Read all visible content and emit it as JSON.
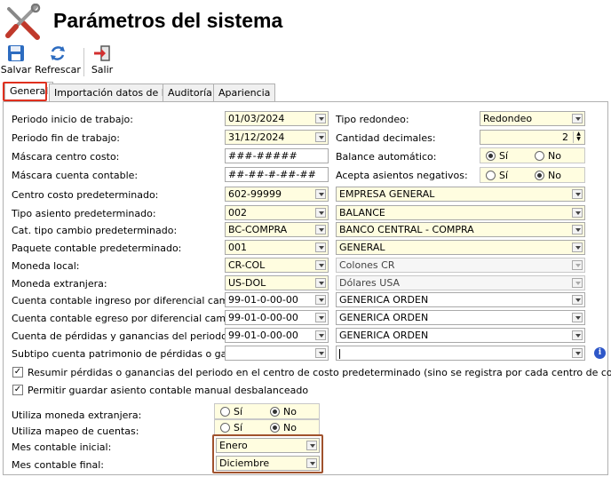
{
  "window": {
    "title": "Parámetros del sistema"
  },
  "toolbar": {
    "save_label": "Salvar",
    "refresh_label": "Refrescar",
    "exit_label": "Salir"
  },
  "tabs": [
    {
      "label": "General",
      "active": true
    },
    {
      "label": "Importación datos de RH"
    },
    {
      "label": "Auditoría"
    },
    {
      "label": "Apariencia"
    }
  ],
  "form": {
    "periodo_inicio": {
      "label": "Periodo inicio de trabajo:",
      "value": "01/03/2024"
    },
    "periodo_fin": {
      "label": "Periodo fin de trabajo:",
      "value": "31/12/2024"
    },
    "mascara_cc": {
      "label": "Máscara centro costo:",
      "value": "###-#####"
    },
    "mascara_cuenta": {
      "label": "Máscara cuenta contable:",
      "value": "##-##-#-##-##"
    },
    "tipo_redondeo": {
      "label": "Tipo redondeo:",
      "value": "Redondeo"
    },
    "cantidad_decimales": {
      "label": "Cantidad decimales:",
      "value": "2"
    },
    "balance_auto": {
      "label": "Balance automático:",
      "si": "Sí",
      "no": "No",
      "selected": "Sí"
    },
    "acepta_neg": {
      "label": "Acepta asientos negativos:",
      "si": "Sí",
      "no": "No",
      "selected": "No"
    },
    "centro_costo": {
      "label": "Centro costo predeterminado:",
      "code": "602-99999",
      "desc": "EMPRESA GENERAL"
    },
    "tipo_asiento": {
      "label": "Tipo asiento predeterminado:",
      "code": "002",
      "desc": "BALANCE"
    },
    "tipo_cambio": {
      "label": "Cat. tipo cambio predeterminado:",
      "code": "BC-COMPRA",
      "desc": "BANCO CENTRAL - COMPRA"
    },
    "paquete": {
      "label": "Paquete contable predeterminado:",
      "code": "001",
      "desc": "GENERAL"
    },
    "moneda_local": {
      "label": "Moneda local:",
      "code": "CR-COL",
      "desc": "Colones CR"
    },
    "moneda_ext": {
      "label": "Moneda extranjera:",
      "code": "US-DOL",
      "desc": "Dólares USA"
    },
    "cta_ingreso": {
      "label": "Cuenta contable ingreso por diferencial cambiario:",
      "code": "99-01-0-00-00",
      "desc": "GENERICA ORDEN"
    },
    "cta_egreso": {
      "label": "Cuenta contable egreso por diferencial cambiario:",
      "code": "99-01-0-00-00",
      "desc": "GENERICA ORDEN"
    },
    "cta_pyg": {
      "label": "Cuenta de pérdidas y ganancias del periodo:",
      "code": "99-01-0-00-00",
      "desc": "GENERICA ORDEN"
    },
    "subtipo": {
      "label": "Subtipo cuenta patrimonio de pérdidas o ganancias:",
      "code": "",
      "desc": ""
    },
    "chk_resumir": {
      "label": "Resumir pérdidas o ganancias del periodo en el centro de costo predeterminado (sino se registra por cada centro de costo).",
      "checked": true
    },
    "chk_permitir": {
      "label": "Permitir guardar asiento contable manual desbalanceado",
      "checked": true
    },
    "usa_moneda_ext": {
      "label": "Utiliza moneda extranjera:",
      "si": "Sí",
      "no": "No",
      "selected": "No"
    },
    "usa_mapeo": {
      "label": "Utiliza mapeo de cuentas:",
      "si": "Sí",
      "no": "No",
      "selected": "No"
    },
    "mes_inicial": {
      "label": "Mes contable inicial:",
      "value": "Enero"
    },
    "mes_final": {
      "label": "Mes contable final:",
      "value": "Diciembre"
    }
  },
  "icons": [
    "tools-icon",
    "save-icon",
    "refresh-icon",
    "exit-icon",
    "info-icon"
  ],
  "colors": {
    "field_yellow": "#fffde0",
    "highlight_red": "#e0301e",
    "highlight_brown": "#a0522d",
    "info_blue": "#2e57c8"
  }
}
